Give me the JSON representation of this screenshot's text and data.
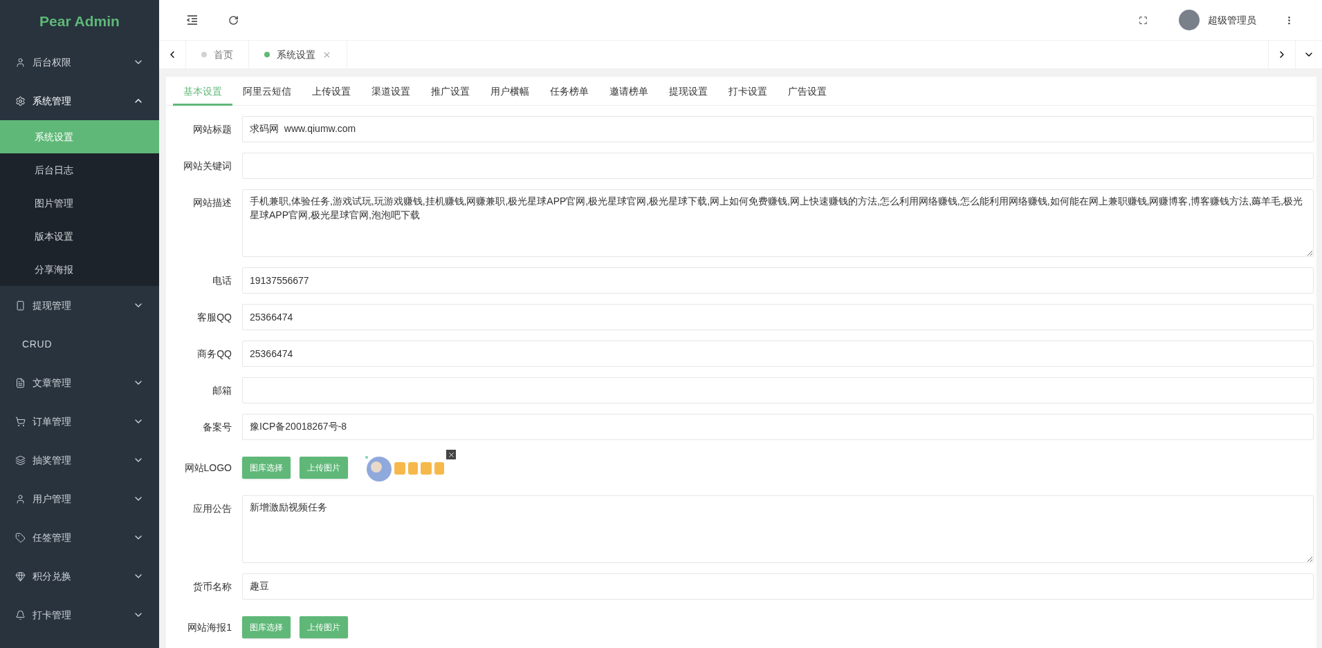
{
  "sidebar": {
    "logo": "Pear Admin",
    "items": [
      {
        "label": "后台权限",
        "expanded": false
      },
      {
        "label": "系统管理",
        "expanded": true,
        "children": [
          {
            "label": "系统设置",
            "selected": true
          },
          {
            "label": "后台日志",
            "selected": false
          },
          {
            "label": "图片管理",
            "selected": false
          },
          {
            "label": "版本设置",
            "selected": false
          },
          {
            "label": "分享海报",
            "selected": false
          }
        ]
      },
      {
        "label": "提现管理",
        "expanded": false
      },
      {
        "label": "CRUD"
      },
      {
        "label": "文章管理",
        "expanded": false
      },
      {
        "label": "订单管理",
        "expanded": false
      },
      {
        "label": "抽奖管理",
        "expanded": false
      },
      {
        "label": "用户管理",
        "expanded": false
      },
      {
        "label": "任签管理",
        "expanded": false
      },
      {
        "label": "积分兑换",
        "expanded": false
      },
      {
        "label": "打卡管理",
        "expanded": false
      }
    ]
  },
  "header": {
    "user": "超级管理员"
  },
  "page_tabs": [
    {
      "label": "首页",
      "selected": false,
      "closable": false
    },
    {
      "label": "系统设置",
      "selected": true,
      "closable": true
    }
  ],
  "settings_tabs": [
    {
      "label": "基本设置",
      "selected": true
    },
    {
      "label": "阿里云短信",
      "selected": false
    },
    {
      "label": "上传设置",
      "selected": false
    },
    {
      "label": "渠道设置",
      "selected": false
    },
    {
      "label": "推广设置",
      "selected": false
    },
    {
      "label": "用户横幅",
      "selected": false
    },
    {
      "label": "任务榜单",
      "selected": false
    },
    {
      "label": "邀请榜单",
      "selected": false
    },
    {
      "label": "提现设置",
      "selected": false
    },
    {
      "label": "打卡设置",
      "selected": false
    },
    {
      "label": "广告设置",
      "selected": false
    }
  ],
  "form": [
    {
      "kind": "input",
      "label": "网站标题",
      "value": "求码网  www.qiumw.com"
    },
    {
      "kind": "input",
      "label": "网站关键词"
    },
    {
      "kind": "textarea",
      "label": "网站描述",
      "value": "手机兼职,体验任务,游戏试玩,玩游戏赚钱,挂机赚钱,网赚兼职,极光星球APP官网,极光星球官网,极光星球下载,网上如何免费赚钱,网上快速赚钱的方法,怎么利用网络赚钱,怎么能利用网络赚钱,如何能在网上兼职赚钱,网赚博客,博客赚钱方法,薅羊毛,极光星球APP官网,极光星球官网,泡泡吧下载"
    },
    {
      "kind": "input",
      "label": "电话",
      "value": "19137556677"
    },
    {
      "kind": "input",
      "label": "客服QQ",
      "value": "25366474"
    },
    {
      "kind": "input",
      "label": "商务QQ",
      "value": "25366474"
    },
    {
      "kind": "input",
      "label": "邮箱"
    },
    {
      "kind": "input",
      "label": "备案号",
      "value": "豫ICP备20018267号-8"
    },
    {
      "kind": "upload",
      "label": "网站LOGO",
      "buttons": [
        "图库选择",
        "上传图片"
      ],
      "has_preview": true
    },
    {
      "kind": "textarea",
      "label": "应用公告",
      "value": "新增激励视频任务"
    },
    {
      "kind": "input",
      "label": "货币名称",
      "value": "趣豆"
    },
    {
      "kind": "upload",
      "label": "网站海报1",
      "buttons": [
        "图库选择",
        "上传图片"
      ],
      "has_preview": false
    }
  ]
}
